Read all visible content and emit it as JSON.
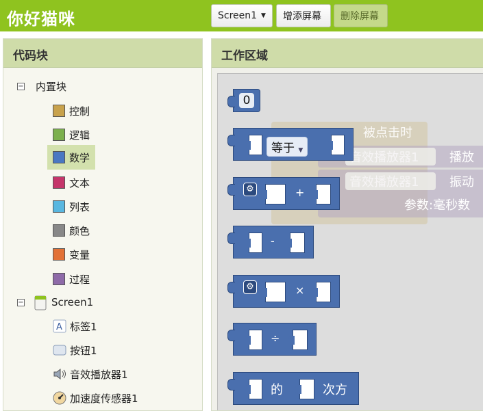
{
  "app": {
    "title": "你好猫咪"
  },
  "toolbar": {
    "screen_select": "Screen1",
    "add_screen": "增添屏幕",
    "remove_screen": "删除屏幕"
  },
  "blocks_panel": {
    "title": "代码块",
    "builtin_label": "内置块",
    "categories": [
      {
        "label": "控制",
        "color": "#c8a24c"
      },
      {
        "label": "逻辑",
        "color": "#7cb04d"
      },
      {
        "label": "数学",
        "color": "#4a78c2"
      },
      {
        "label": "文本",
        "color": "#c4356a"
      },
      {
        "label": "列表",
        "color": "#59b7e0"
      },
      {
        "label": "颜色",
        "color": "#888888"
      },
      {
        "label": "变量",
        "color": "#e27136"
      },
      {
        "label": "过程",
        "color": "#8e6aa8"
      }
    ],
    "screen_label": "Screen1",
    "components": [
      {
        "label": "标签1",
        "icon": "label-icon"
      },
      {
        "label": "按钮1",
        "icon": "button-icon"
      },
      {
        "label": "音效播放器1",
        "icon": "sound-icon"
      },
      {
        "label": "加速度传感器1",
        "icon": "accelerometer-icon"
      }
    ]
  },
  "work_panel": {
    "title": "工作区域",
    "number_block_value": "0",
    "compare_op": "等于",
    "add_op": "+",
    "subtract_op": "-",
    "multiply_op": "×",
    "divide_op": "÷",
    "power_of": "的",
    "power_label": "次方",
    "ghost": {
      "when_clicked": "被点击时",
      "sound_player_1": "音效播放器1",
      "play": "播放",
      "sound_player_2": "音效播放器1",
      "vibrate": "振动",
      "param_ms": "参数:毫秒数"
    }
  }
}
